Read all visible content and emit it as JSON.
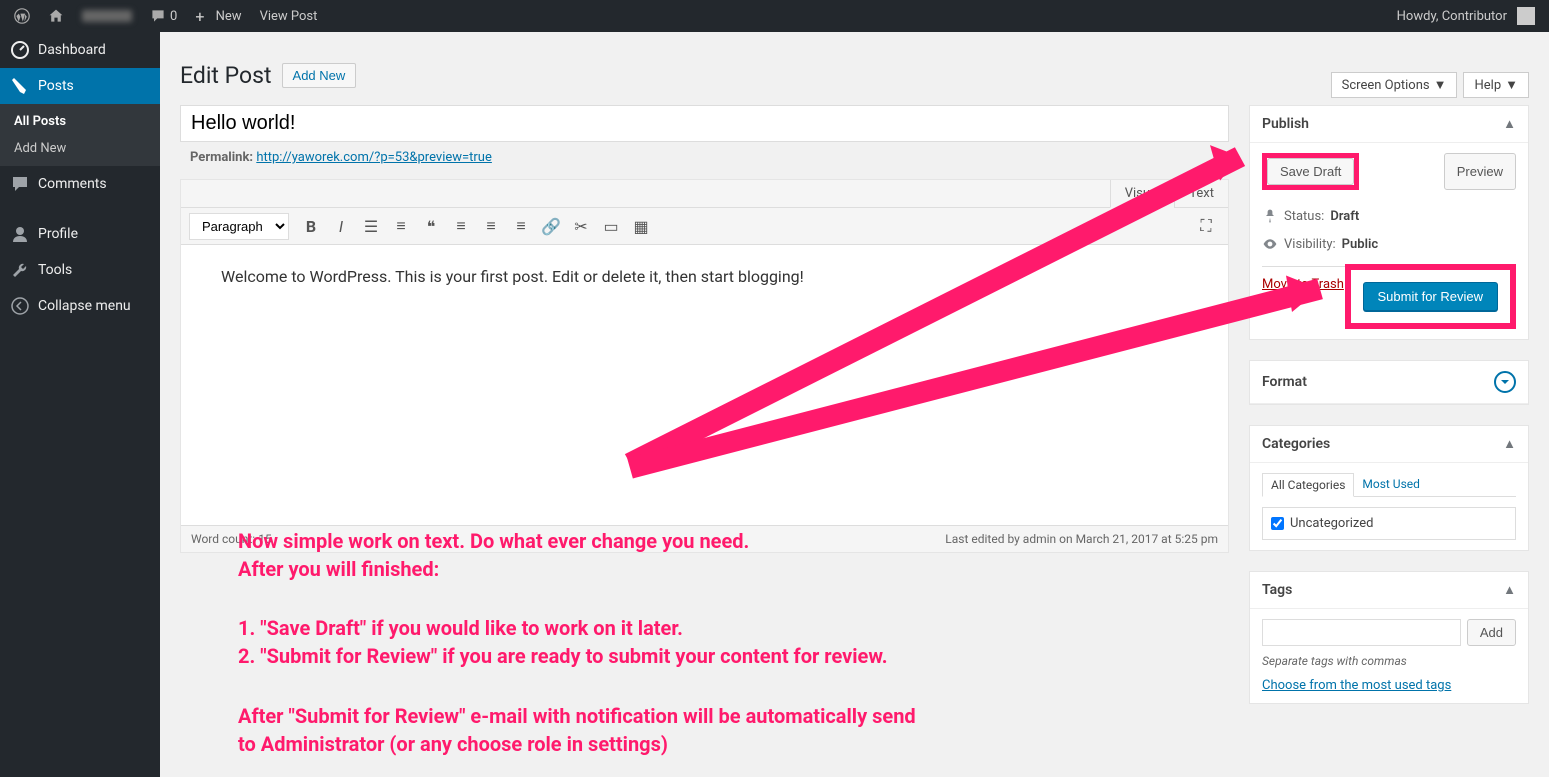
{
  "topbar": {
    "comments_count": "0",
    "new": "New",
    "view_post": "View Post",
    "howdy": "Howdy, Contributor"
  },
  "sidebar": {
    "dashboard": "Dashboard",
    "posts": "Posts",
    "all_posts": "All Posts",
    "add_new": "Add New",
    "comments": "Comments",
    "profile": "Profile",
    "tools": "Tools",
    "collapse": "Collapse menu"
  },
  "topright": {
    "screen_options": "Screen Options",
    "help": "Help"
  },
  "page": {
    "title": "Edit Post",
    "add_new": "Add New",
    "post_title": "Hello world!",
    "permalink_label": "Permalink:",
    "permalink_url": "http://yaworek.com/?p=53&preview=true"
  },
  "editor": {
    "visual_tab": "Visual",
    "text_tab": "Text",
    "format_select": "Paragraph",
    "content": "Welcome to WordPress. This is your first post. Edit or delete it, then start blogging!",
    "word_count_label": "Word count:",
    "word_count": "15",
    "last_edited": "Last edited by admin on March 21, 2017 at 5:25 pm"
  },
  "publish": {
    "header": "Publish",
    "save_draft": "Save Draft",
    "preview": "Preview",
    "status_label": "Status:",
    "status_value": "Draft",
    "visibility_label": "Visibility:",
    "visibility_value": "Public",
    "move_trash": "Move to Trash",
    "submit": "Submit for Review"
  },
  "format": {
    "header": "Format"
  },
  "categories": {
    "header": "Categories",
    "all_tab": "All Categories",
    "most_used_tab": "Most Used",
    "item_label": "Uncategorized"
  },
  "tags": {
    "header": "Tags",
    "add": "Add",
    "help": "Separate tags with commas",
    "choose_link": "Choose from the most used tags"
  },
  "annotations": {
    "line1": "Now simple work on text. Do what ever change you need.",
    "line2": "After you will finished:",
    "step1": "1. \"Save Draft\" if you would like to work on it later.",
    "step2": "2. \"Submit for Review\" if you are ready to submit your content for review.",
    "note1": "After \"Submit for Review\" e-mail with notification will be automatically send",
    "note2": "to Administrator (or any choose role in settings)"
  }
}
